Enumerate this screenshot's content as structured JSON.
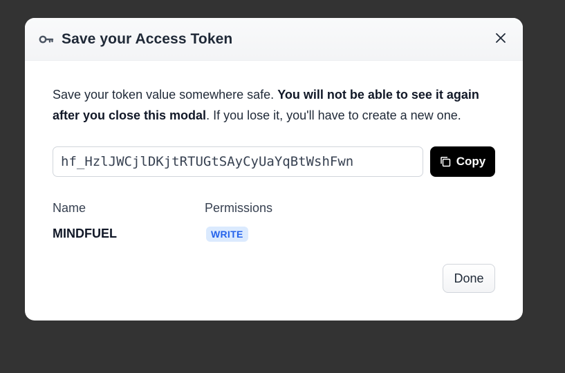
{
  "modal": {
    "title": "Save your Access Token",
    "title_icon": "key-icon",
    "close_icon": "close-icon",
    "description": {
      "part1": "Save your token value somewhere safe. ",
      "bold": "You will not be able to see it again after you close this modal",
      "part2": ". If you lose it, you'll have to create a new one."
    },
    "token_value": "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",
    "copy_label": "Copy",
    "copy_icon": "copy-icon",
    "name_label": "Name",
    "permissions_label": "Permissions",
    "name_value": "MINDFUEL",
    "permission_value": "WRITE",
    "done_label": "Done"
  },
  "colors": {
    "backdrop": "#333333",
    "copy_button_bg": "#000000",
    "badge_bg": "#dbeafe",
    "badge_text": "#2563eb"
  }
}
